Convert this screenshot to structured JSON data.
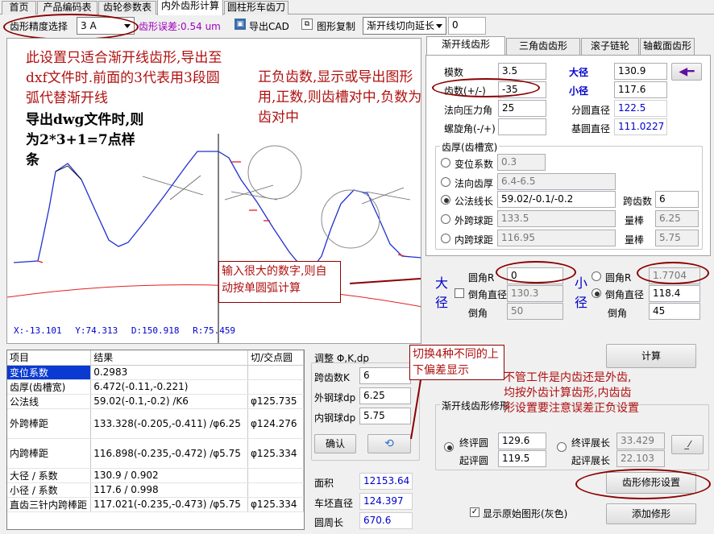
{
  "top_tabs": [
    "首页",
    "产品编码表",
    "齿轮参数表",
    "内外齿形计算",
    "圆柱形车齿刀"
  ],
  "toolbar": {
    "precision_label": "齿形精度选择",
    "precision_value": "3 A",
    "error_text": "齿形误差:0.54 um",
    "export_cad": "导出CAD",
    "copy_graph": "图形复制",
    "mode_value": "渐开线切向延长",
    "offset_value": "0"
  },
  "notes": {
    "note1": "此设置只适合渐开线齿形,导出至dxf文件时.前面的3代表用3段圆弧代替渐开线",
    "note2": "导出dwg文件时,则为2*3+1=7点样条",
    "note3": "正负齿数,显示或导出图形用,正数,则齿槽对中,负数为齿对中",
    "note4": "输入很大的数字,则自动按单圆弧计算",
    "note5": "切换4种不同的上下偏差显示",
    "note6": "不管工件是内齿还是外齿,均按外齿计算齿形,内齿齿形设置要注意误差正负设置"
  },
  "coords": {
    "x": "X:-13.101",
    "y": "Y:74.313",
    "d": "D:150.918",
    "r": "R:75.459"
  },
  "right_tabs": [
    "渐开线齿形",
    "三角齿齿形",
    "滚子链轮",
    "轴截面齿形"
  ],
  "params": {
    "module_label": "模数",
    "module_value": "3.5",
    "teeth_label": "齿数(+/-)",
    "teeth_value": "-35",
    "pressure_label": "法向压力角",
    "pressure_value": "25",
    "helix_label": "螺旋角(-/+)",
    "helix_value": "",
    "major_label": "大径",
    "major_value": "130.9",
    "minor_label": "小径",
    "minor_value": "117.6",
    "pitch_label": "分圆直径",
    "pitch_value": "122.5",
    "base_label": "基圆直径",
    "base_value": "111.0227"
  },
  "thickness": {
    "group_label": "齿厚(齿槽宽)",
    "shift_label": "变位系数",
    "shift_value": "0.3",
    "normal_label": "法向齿厚",
    "normal_value": "6.4-6.5",
    "wk_label": "公法线长",
    "wk_value": "59.02/-0.1/-0.2",
    "span_label": "跨齿数",
    "span_value": "6",
    "ext_ball_label": "外跨球距",
    "ext_ball_value": "133.5",
    "ext_rod_label": "量棒",
    "ext_rod_value": "6.25",
    "int_ball_label": "内跨球距",
    "int_ball_value": "116.95",
    "int_rod_label": "量棒",
    "int_rod_value": "5.75"
  },
  "fillet": {
    "big_label": "大径",
    "big_r_label": "圆角R",
    "big_r_value": "0",
    "big_chamfer_label": "倒角直径",
    "big_chamfer_value": "130.3",
    "big_angle_label": "倒角",
    "big_angle_value": "50",
    "small_label": "小径",
    "small_r_label": "圆角R",
    "small_r_value": "1.7704",
    "small_chamfer_label": "倒角直径",
    "small_chamfer_value": "118.4",
    "small_angle_label": "倒角",
    "small_angle_value": "45"
  },
  "calc_button": "计算",
  "results": {
    "headers": [
      "项目",
      "结果",
      "切/交点圆"
    ],
    "rows": [
      [
        "变位系数",
        "0.2983",
        ""
      ],
      [
        "齿厚(齿槽宽)",
        "6.472(-0.11,-0.221)",
        ""
      ],
      [
        "公法线",
        "59.02(-0.1,-0.2) /K6",
        "φ125.735"
      ],
      [
        "外跨棒距",
        "133.328(-0.205,-0.411) /φ6.25",
        "φ124.276"
      ],
      [
        "内跨棒距",
        "116.898(-0.235,-0.472) /φ5.75",
        "φ125.334"
      ],
      [
        "大径 / 系数",
        "130.9 / 0.902",
        ""
      ],
      [
        "小径 / 系数",
        "117.6 / 0.998",
        ""
      ],
      [
        "直齿三针内跨棒距",
        "117.021(-0.235,-0.473) /φ5.75",
        "φ125.334"
      ]
    ]
  },
  "adjust": {
    "title": "调整 Φ,K,dp",
    "span_label": "跨齿数K",
    "span_value": "6",
    "ext_label": "外钢球dp",
    "ext_value": "6.25",
    "int_label": "内钢球dp",
    "int_value": "5.75",
    "ok_button": "确认"
  },
  "area": {
    "area_label": "面积",
    "area_value": "12153.64",
    "blank_label": "车坯直径",
    "blank_value": "124.397",
    "perim_label": "圆周长",
    "perim_value": "670.6"
  },
  "modify": {
    "group_label": "渐开线齿形修形",
    "end_circle_label": "终评圆",
    "end_circle_value": "129.6",
    "start_circle_label": "起评圆",
    "start_circle_value": "119.5",
    "end_len_label": "终评展长",
    "end_len_value": "33.429",
    "start_len_label": "起评展长",
    "start_len_value": "22.103",
    "setting_button": "齿形修形设置",
    "add_button": "添加修形",
    "show_original": "显示原始图形(灰色)"
  }
}
